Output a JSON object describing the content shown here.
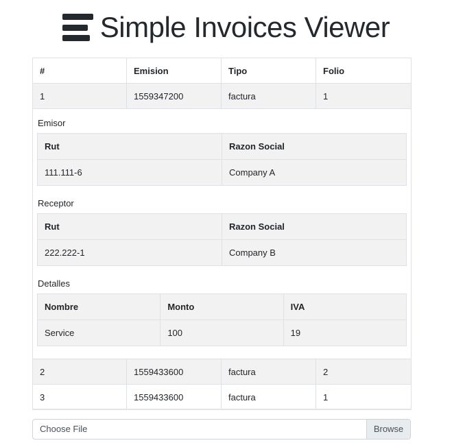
{
  "header": {
    "title": "Simple Invoices Viewer",
    "icon": "hamburger-menu-icon"
  },
  "invoices": {
    "columns": [
      "#",
      "Emision",
      "Tipo",
      "Folio"
    ],
    "rows": [
      {
        "num": "1",
        "emision": "1559347200",
        "tipo": "factura",
        "folio": "1"
      },
      {
        "num": "2",
        "emision": "1559433600",
        "tipo": "factura",
        "folio": "2"
      },
      {
        "num": "3",
        "emision": "1559433600",
        "tipo": "factura",
        "folio": "1"
      }
    ]
  },
  "detail": {
    "emisor": {
      "label": "Emisor",
      "columns": [
        "Rut",
        "Razon Social"
      ],
      "values": [
        "111.111-6",
        "Company A"
      ]
    },
    "receptor": {
      "label": "Receptor",
      "columns": [
        "Rut",
        "Razon Social"
      ],
      "values": [
        "222.222-1",
        "Company B"
      ]
    },
    "detalles": {
      "label": "Detalles",
      "columns": [
        "Nombre",
        "Monto",
        "IVA"
      ],
      "values": [
        "Service",
        "100",
        "19"
      ]
    }
  },
  "file_input": {
    "label": "Choose File",
    "button": "Browse"
  }
}
